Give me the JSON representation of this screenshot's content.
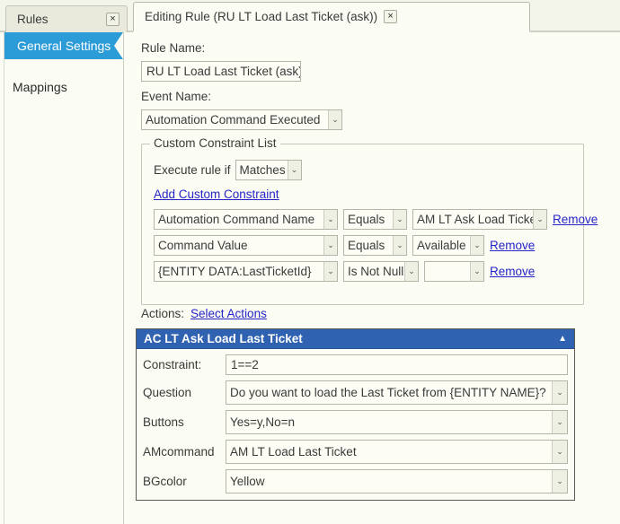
{
  "tabs": [
    {
      "label": "Rules",
      "active": false,
      "close_icon": "×"
    },
    {
      "label": "Editing Rule (RU LT Load Last Ticket (ask))",
      "active": true,
      "close_icon": "×"
    }
  ],
  "sidebar": {
    "items": [
      {
        "label": "General Settings",
        "selected": true
      },
      {
        "label": "Mappings",
        "selected": false
      }
    ]
  },
  "form": {
    "rule_name_label": "Rule Name:",
    "rule_name_value": "RU LT Load Last Ticket (ask)",
    "event_name_label": "Event Name:",
    "event_name_value": "Automation Command Executed"
  },
  "constraint_list": {
    "legend": "Custom Constraint List",
    "execute_label": "Execute rule if",
    "execute_value": "Matches",
    "add_link": "Add Custom Constraint",
    "remove_label": "Remove",
    "rows": [
      {
        "field": "Automation Command Name",
        "operator": "Equals",
        "value": "AM LT Ask Load Ticket",
        "remove": "Remove"
      },
      {
        "field": "Command Value",
        "operator": "Equals",
        "value": "Available",
        "remove": "Remove"
      },
      {
        "field": "{ENTITY DATA:LastTicketId}",
        "operator": "Is Not Null",
        "value": "",
        "remove": "Remove"
      }
    ]
  },
  "actions": {
    "label": "Actions:",
    "select_link": "Select Actions",
    "panel": {
      "title": "AC LT Ask Load Last Ticket",
      "collapse_icon": "▲",
      "fields": [
        {
          "label": "Constraint:",
          "value": "1==2",
          "type": "text"
        },
        {
          "label": "Question",
          "value": "Do you want to load the Last Ticket from {ENTITY NAME}?",
          "type": "combo"
        },
        {
          "label": "Buttons",
          "value": "Yes=y,No=n",
          "type": "combo"
        },
        {
          "label": "AMcommand",
          "value": "AM LT Load Last Ticket",
          "type": "combo"
        },
        {
          "label": "BGcolor",
          "value": "Yellow",
          "type": "combo"
        }
      ]
    }
  },
  "icons": {
    "dropdown_arrow": "⌄"
  },
  "colors": {
    "accent_blue": "#2c9cd8",
    "panel_header_blue": "#2f62b0",
    "link_blue": "#2424c8",
    "page_bg": "#fbfcf3"
  }
}
